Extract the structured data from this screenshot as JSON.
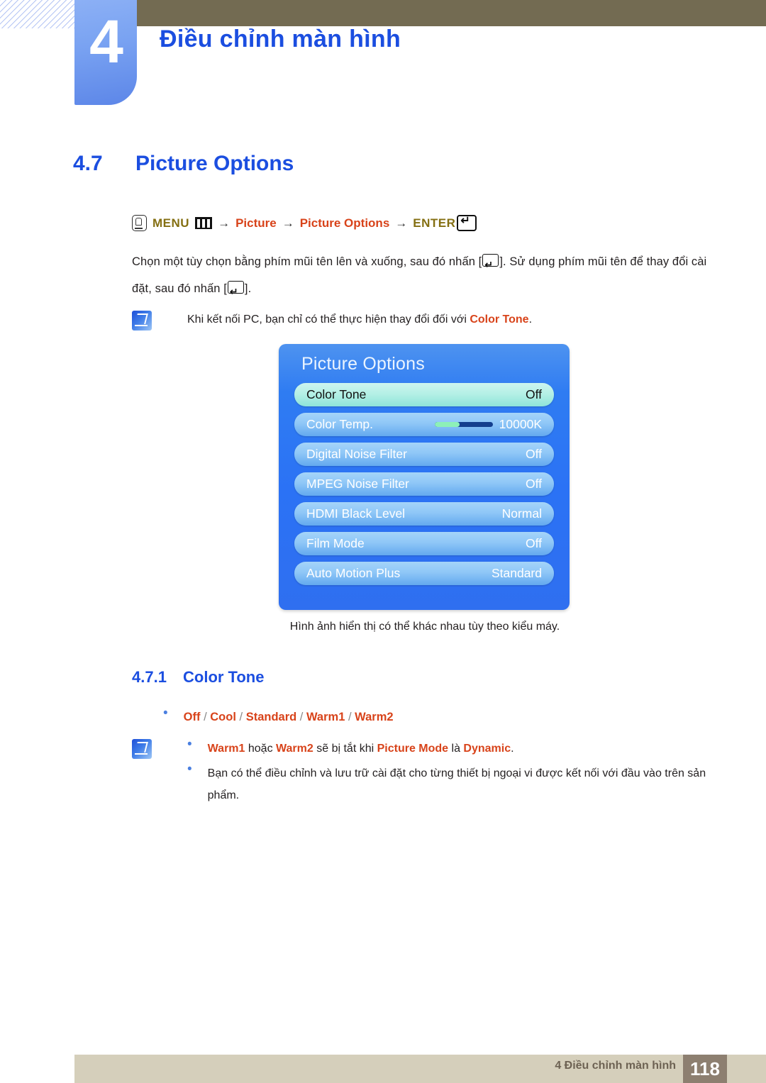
{
  "header": {
    "chapter_number": "4",
    "chapter_title": "Điều chỉnh màn hình"
  },
  "section": {
    "number": "4.7",
    "title": "Picture Options"
  },
  "menu_path": {
    "mouse_icon": "mouse-click-icon",
    "menu_label": "MENU",
    "bars_icon": "menu-bars-icon",
    "arrow1": "→",
    "item1": "Picture",
    "arrow2": "→",
    "item2": "Picture Options",
    "arrow3": "→",
    "enter_label": "ENTER",
    "enter_icon": "enter-key-icon"
  },
  "body": {
    "para_part1": "Chọn một tùy chọn bằng phím mũi tên lên và xuống, sau đó nhấn [",
    "para_part2": "]. Sử dụng phím mũi tên để thay đổi cài đặt, sau đó nhấn [",
    "para_part3": "].",
    "note_pc_part1": "Khi kết nối PC, bạn chỉ có thể thực hiện thay đổi đối với ",
    "note_pc_highlight": "Color Tone",
    "note_pc_part2": "."
  },
  "osd": {
    "title": "Picture Options",
    "rows": [
      {
        "label": "Color Tone",
        "value": "Off",
        "selected": true,
        "slider": false
      },
      {
        "label": "Color Temp.",
        "value": "10000K",
        "selected": false,
        "slider": true,
        "slider_percent": 43
      },
      {
        "label": "Digital Noise Filter",
        "value": "Off",
        "selected": false,
        "slider": false
      },
      {
        "label": "MPEG Noise Filter",
        "value": "Off",
        "selected": false,
        "slider": false
      },
      {
        "label": "HDMI Black Level",
        "value": "Normal",
        "selected": false,
        "slider": false
      },
      {
        "label": "Film Mode",
        "value": "Off",
        "selected": false,
        "slider": false
      },
      {
        "label": "Auto Motion Plus",
        "value": "Standard",
        "selected": false,
        "slider": false
      }
    ],
    "caption": "Hình ảnh hiển thị có thể khác nhau tùy theo kiểu máy."
  },
  "subsection": {
    "number": "4.7.1",
    "title": "Color Tone",
    "options": [
      "Off",
      "Cool",
      "Standard",
      "Warm1",
      "Warm2"
    ],
    "options_separator": "/"
  },
  "notes_bottom": [
    {
      "segments": [
        {
          "text": "Warm1",
          "style": "red-bold"
        },
        {
          "text": " hoặc ",
          "style": "plain"
        },
        {
          "text": "Warm2",
          "style": "red-bold"
        },
        {
          "text": " sẽ bị tắt khi ",
          "style": "plain"
        },
        {
          "text": "Picture Mode",
          "style": "red-bold"
        },
        {
          "text": " là ",
          "style": "plain"
        },
        {
          "text": "Dynamic",
          "style": "red-bold"
        },
        {
          "text": ".",
          "style": "plain"
        }
      ]
    },
    {
      "segments": [
        {
          "text": "Bạn có thể điều chỉnh và lưu trữ cài đặt cho từng thiết bị ngoại vi được kết nối với đầu vào trên sản phẩm.",
          "style": "plain"
        }
      ]
    }
  ],
  "footer": {
    "text": "4 Điều chỉnh màn hình",
    "page_number": "118"
  },
  "colors": {
    "brand_blue": "#1b4ee0",
    "accent_red": "#d8431a",
    "olive": "#846f12",
    "header_bar": "#736b52",
    "footer_bar": "#d5cfbb",
    "footer_page_box": "#8d7f70",
    "osd_blue": "#2b72f5",
    "osd_row": "#8fc7f7",
    "osd_row_selected": "#b5f0e6",
    "slider_fill": "#8df0b8",
    "slider_track": "#143f8e"
  }
}
